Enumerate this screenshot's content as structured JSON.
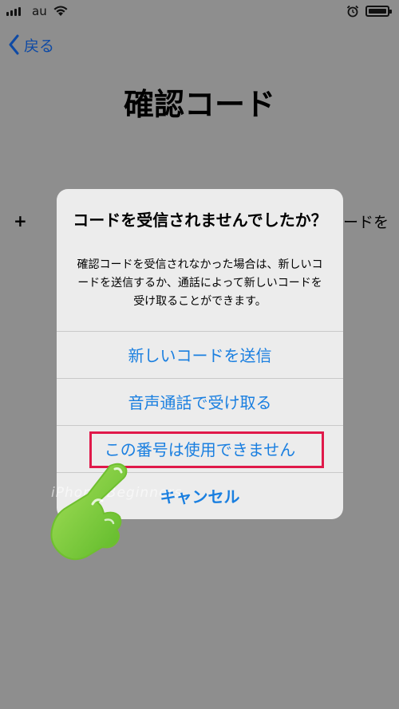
{
  "status_bar": {
    "carrier": "au"
  },
  "nav": {
    "back_label": "戻る"
  },
  "page": {
    "title": "確認コード",
    "bg_plus": "+",
    "bg_right_text": "ードを"
  },
  "alert": {
    "title": "コードを受信されませんでしたか？",
    "message": "確認コードを受信されなかった場合は、新しいコードを送信するか、通話によって新しいコードを受け取ることができます。",
    "buttons": [
      {
        "label": "新しいコードを送信"
      },
      {
        "label": "音声通話で受け取る"
      },
      {
        "label": "この番号は使用できません"
      },
      {
        "label": "キャンセル"
      }
    ]
  },
  "overlay": {
    "watermark": "iPhone Beginners"
  },
  "colors": {
    "accent": "#1a7fe0",
    "highlight": "#e0194a",
    "dim_background": "#8e8e8e",
    "back_link": "#0e4aa5"
  },
  "icons": [
    "signal-icon",
    "wifi-icon",
    "alarm-icon",
    "battery-icon",
    "chevron-left-icon",
    "pointing-hand-icon"
  ]
}
